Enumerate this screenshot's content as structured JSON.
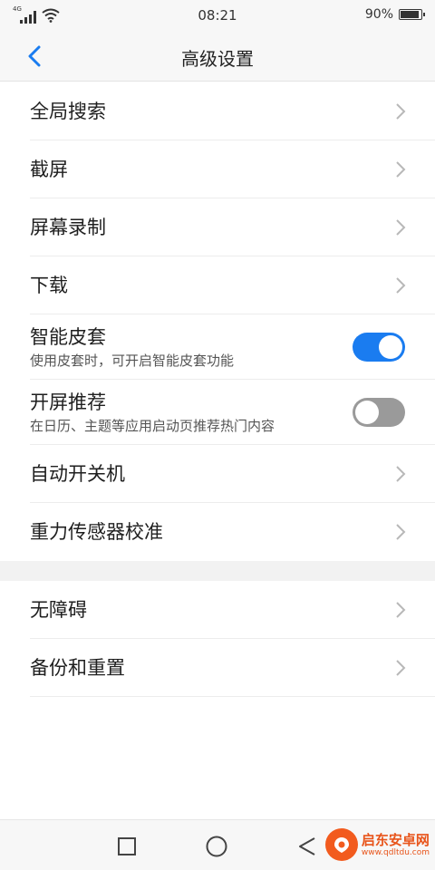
{
  "status_bar": {
    "network": "4G",
    "time": "08:21",
    "battery": "90%",
    "battery_level": 0.9
  },
  "header": {
    "title": "高级设置"
  },
  "settings": {
    "global_search": "全局搜索",
    "screenshot": "截屏",
    "screen_record": "屏幕录制",
    "download": "下载",
    "smart_cover": {
      "title": "智能皮套",
      "subtitle": "使用皮套时，可开启智能皮套功能",
      "enabled": true
    },
    "boot_recommend": {
      "title": "开屏推荐",
      "subtitle": "在日历、主题等应用启动页推荐热门内容",
      "enabled": false
    },
    "auto_power": "自动开关机",
    "gravity_calibration": "重力传感器校准",
    "accessibility": "无障碍",
    "backup_reset": "备份和重置"
  },
  "colors": {
    "accent": "#1a7cf0",
    "toggle_off": "#9a9a9a"
  },
  "watermark": {
    "name": "启东安卓网",
    "url": "www.qdltdu.com"
  }
}
